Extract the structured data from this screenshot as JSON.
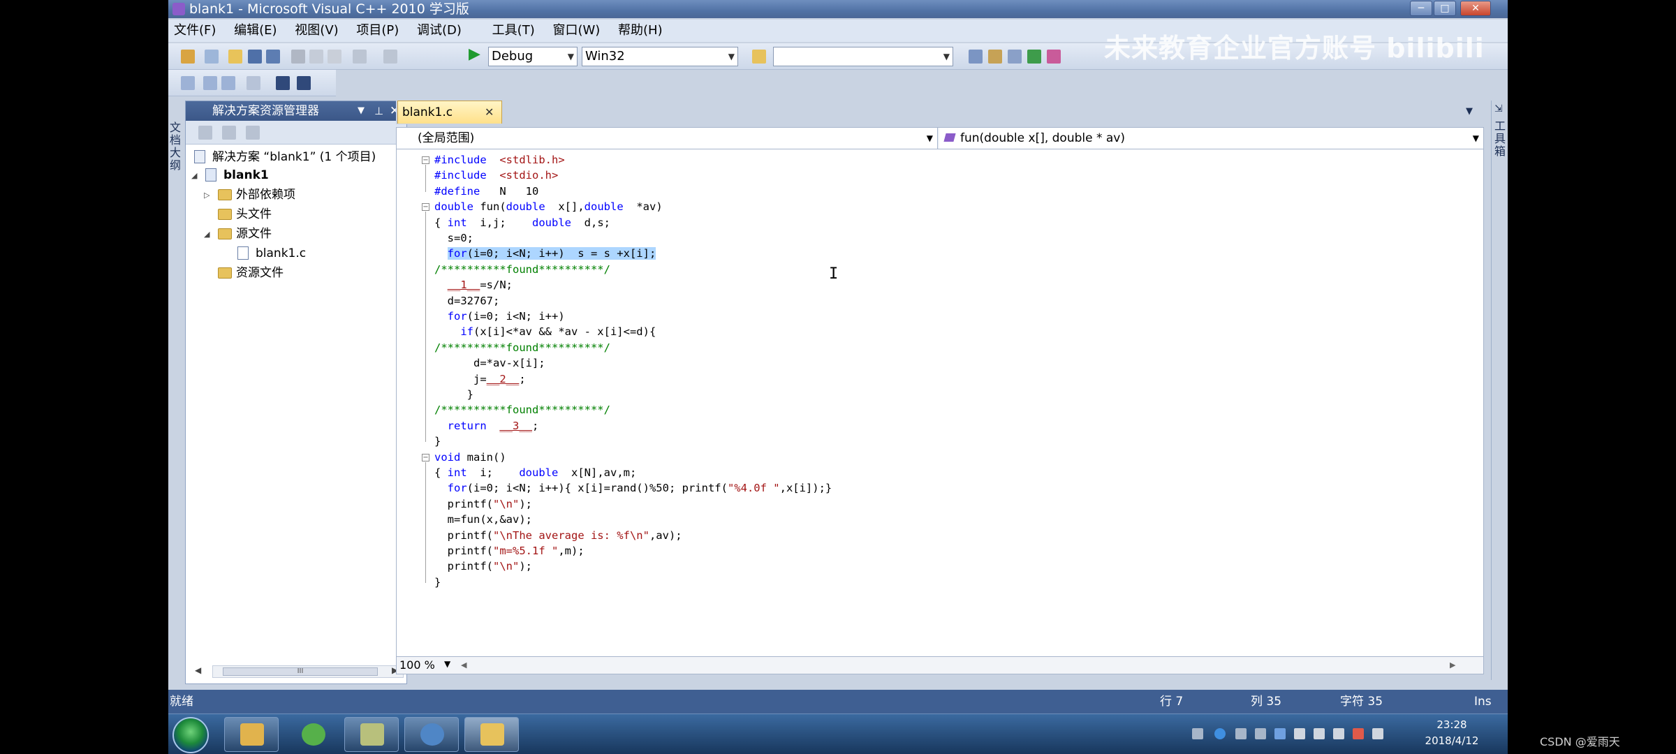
{
  "window": {
    "title": "blank1 - Microsoft Visual C++ 2010 学习版",
    "min_label": "─",
    "max_label": "□",
    "close_label": "✕"
  },
  "menu": [
    "文件(F)",
    "编辑(E)",
    "视图(V)",
    "项目(P)",
    "调试(D)",
    "工具(T)",
    "窗口(W)",
    "帮助(H)"
  ],
  "toolbar": {
    "config": "Debug",
    "platform": "Win32",
    "find_combo": "",
    "watermark": "未来教育企业官方账号 bilibili"
  },
  "solution_explorer": {
    "title": "解决方案资源管理器",
    "solution": "解决方案 “blank1” (1 个项目)",
    "project": "blank1",
    "items": [
      "外部依赖项",
      "头文件",
      "源文件",
      "blank1.c",
      "资源文件"
    ],
    "scroll_grip": "III"
  },
  "left_rail": {
    "label": "文档大纲"
  },
  "right_rail": {
    "label": "工具箱"
  },
  "editor": {
    "tab_label": "blank1.c",
    "scope": "(全局范围)",
    "function": "fun(double x[], double * av)",
    "zoom": "100 %",
    "code": [
      {
        "t": "pp",
        "s": "#include  <stdlib.h>"
      },
      {
        "t": "pp",
        "s": "#include  <stdio.h>"
      },
      {
        "t": "pp",
        "s": "#define   N   10"
      },
      {
        "t": "fn",
        "s": "double fun(double  x[],double  *av)"
      },
      {
        "t": "c",
        "s": "{ int  i,j;    double  d,s;"
      },
      {
        "t": "c",
        "s": "  s=0;"
      },
      {
        "t": "hl",
        "s": "  for(i=0; i<N; i++)  s = s +x[i];"
      },
      {
        "t": "cm",
        "s": "/**********found**********/"
      },
      {
        "t": "c",
        "s": "  __1__=s/N;"
      },
      {
        "t": "c",
        "s": "  d=32767;"
      },
      {
        "t": "c",
        "s": "  for(i=0; i<N; i++)"
      },
      {
        "t": "c",
        "s": "    if(x[i]<*av && *av - x[i]<=d){"
      },
      {
        "t": "cm",
        "s": "/**********found**********/"
      },
      {
        "t": "c",
        "s": "      d=*av-x[i];"
      },
      {
        "t": "c",
        "s": "      j=__2__;"
      },
      {
        "t": "c",
        "s": "     }"
      },
      {
        "t": "cm",
        "s": "/**********found**********/"
      },
      {
        "t": "c",
        "s": "  return  __3__;"
      },
      {
        "t": "c",
        "s": "}"
      },
      {
        "t": "fn",
        "s": "void main()"
      },
      {
        "t": "c",
        "s": "{ int  i;    double  x[N],av,m;"
      },
      {
        "t": "c",
        "s": "  for(i=0; i<N; i++){ x[i]=rand()%50; printf(\"%4.0f \",x[i]);}"
      },
      {
        "t": "c",
        "s": "  printf(\"\\n\");"
      },
      {
        "t": "c",
        "s": "  m=fun(x,&av);"
      },
      {
        "t": "c",
        "s": "  printf(\"\\nThe average is: %f\\n\",av);"
      },
      {
        "t": "c",
        "s": "  printf(\"m=%5.1f \",m);"
      },
      {
        "t": "c",
        "s": "  printf(\"\\n\");"
      },
      {
        "t": "c",
        "s": "}"
      }
    ]
  },
  "status": {
    "ready": "就绪",
    "line": "行 7",
    "col": "列 35",
    "ch": "字符 35",
    "mode": "Ins"
  },
  "taskbar": {
    "time": "23:28",
    "date": "2018/4/12"
  },
  "overlay": {
    "csdn": "CSDN @爱雨天"
  },
  "colors": {
    "keyword": "#0000ff",
    "comment": "#008000",
    "string": "#a31515",
    "highlight": "#add6ff",
    "statusbar": "#3f5f92"
  }
}
